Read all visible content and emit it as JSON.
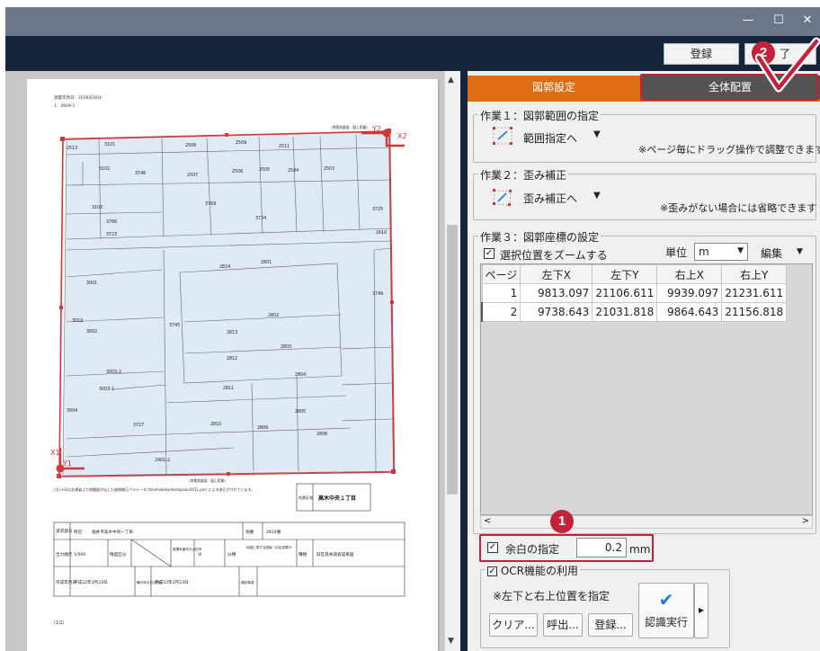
{
  "window": {
    "minimize": "—",
    "maximize": "☐",
    "close": "✕"
  },
  "toolbar": {
    "register_label": "登録",
    "end_label": "了"
  },
  "tabs": [
    {
      "label": "図郭設定",
      "active": true
    },
    {
      "label": "全体配置",
      "active": false
    }
  ],
  "task1": {
    "title": "作業１：図郭範囲の指定",
    "action_label": "範囲指定へ",
    "note": "※ページ毎にドラッグ操作で調整できます"
  },
  "task2": {
    "title": "作業２：歪み補正",
    "action_label": "歪み補正へ",
    "note": "※歪みがない場合には省略できます"
  },
  "task3": {
    "title": "作業３：図郭座標の設定",
    "zoom_checkbox_label": "選択位置をズームする",
    "zoom_checked": true,
    "unit_label": "単位",
    "unit_value": "m",
    "edit_label": "編集"
  },
  "grid": {
    "columns": [
      "ページ",
      "左下X",
      "左下Y",
      "右上X",
      "右上Y"
    ],
    "rows": [
      [
        "1",
        "9813.097",
        "21106.611",
        "9939.097",
        "21231.611"
      ],
      [
        "2",
        "9738.643",
        "21031.818",
        "9864.643",
        "21156.818"
      ]
    ]
  },
  "margin": {
    "label": "余白の指定",
    "checked": true,
    "value": "0.2",
    "unit": "mm"
  },
  "ocr": {
    "title": "OCR機能の利用",
    "checked": true,
    "note": "※左下と右上位置を指定",
    "clear_label": "クリア...",
    "call_label": "呼出...",
    "register_label": "登録...",
    "recognize_label": "認識実行"
  },
  "callouts": {
    "one": "1",
    "two": "2"
  },
  "document": {
    "header_line1": "測量年月日：2016/03/04",
    "header_line2": "1　2609-1",
    "scale_note_top": "(地積測量図：図上距離)",
    "scale_note_bottom": "(地積測量図：図上距離)",
    "parcels": [
      "2513",
      "3101",
      "2508",
      "2509",
      "2511",
      "3102",
      "3746",
      "2507",
      "2506",
      "2505",
      "2504",
      "2503",
      "3103",
      "3769",
      "3725",
      "3766",
      "3724",
      "2610",
      "3723",
      "2814",
      "2801",
      "3001",
      "3749",
      "3019",
      "3002",
      "3745",
      "2813",
      "2802",
      "2803",
      "2812",
      "3003-2",
      "2804",
      "3003-1",
      "2811",
      "2805",
      "3004",
      "3727",
      "2810",
      "2809",
      "2806",
      "2901-2"
    ],
    "footer_note": "(注)＊印は交通省より地籍図が出した座標補正パラメータ (tkoshokekai/koshpsek/2011.par) による修正がされています。",
    "location_box_label": "地番区域",
    "location_box_value": "高木中央１丁目",
    "table_address_head": "請求部分",
    "table_address_label": "所在",
    "table_address_value": "福井市高木中央一丁目",
    "table_lot_label": "地番",
    "table_lot_value": "2814番",
    "table_scale_label": "出力縮尺",
    "table_scale_value": "1/500",
    "table_precision_label": "精度区分",
    "table_coord_label": "座標系番号又は記号",
    "table_coord_value": "VI",
    "table_class_label": "分類",
    "table_class_value": "地図に準ずる図面（旧区成果Ｂ",
    "table_type_label": "種類",
    "table_type_value": "旧区基本調査成果図",
    "table_date_label": "作成年月日",
    "table_date_value": "平成22年3月23日",
    "table_issue_label": "備付年月日(原図)",
    "table_issue_value": "平成22年3月23日",
    "table_remarks_label": "補記事項",
    "page_counter": "(1/1)",
    "y2_label": "Y2",
    "x2_label": "X2",
    "y1_label": "Y1",
    "x1_label": "X1"
  },
  "colors": {
    "accent": "#e06c12",
    "callout": "#c4223a",
    "title_bar": "#6c7689",
    "menu_bar": "#14243a",
    "map_fill": "#dfeaf5",
    "frame": "#d0393b"
  }
}
